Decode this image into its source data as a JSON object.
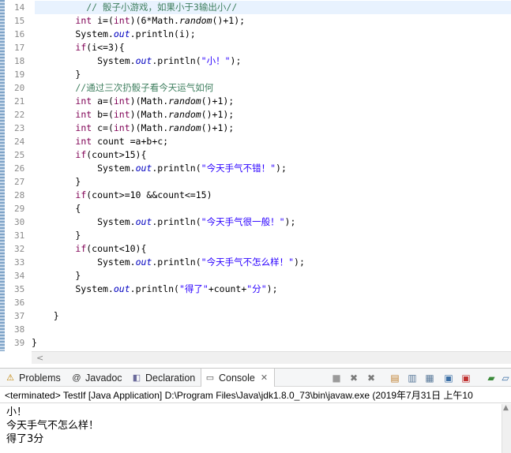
{
  "editor": {
    "line_numbers": [
      "14",
      "15",
      "16",
      "17",
      "18",
      "19",
      "20",
      "21",
      "22",
      "23",
      "24",
      "25",
      "26",
      "27",
      "28",
      "29",
      "30",
      "31",
      "32",
      "33",
      "34",
      "35",
      "36",
      "37",
      "38",
      "39"
    ],
    "lines": [
      [
        {
          "t": "          // 骰子小游戏，如果小于3输出小//",
          "c": "cm"
        }
      ],
      [
        {
          "t": "        ",
          "c": ""
        },
        {
          "t": "int",
          "c": "kw"
        },
        {
          "t": " i=(",
          "c": ""
        },
        {
          "t": "int",
          "c": "kw"
        },
        {
          "t": ")(6*Math.",
          "c": ""
        },
        {
          "t": "random",
          "c": "it"
        },
        {
          "t": "()+1);",
          "c": ""
        }
      ],
      [
        {
          "t": "        System.",
          "c": ""
        },
        {
          "t": "out",
          "c": "fld"
        },
        {
          "t": ".println(i);",
          "c": ""
        }
      ],
      [
        {
          "t": "        ",
          "c": ""
        },
        {
          "t": "if",
          "c": "kw"
        },
        {
          "t": "(i<=3){",
          "c": ""
        }
      ],
      [
        {
          "t": "            System.",
          "c": ""
        },
        {
          "t": "out",
          "c": "fld"
        },
        {
          "t": ".println(",
          "c": ""
        },
        {
          "t": "\"小！\"",
          "c": "st"
        },
        {
          "t": ");",
          "c": ""
        }
      ],
      [
        {
          "t": "        }",
          "c": ""
        }
      ],
      [
        {
          "t": "        //通过三次扔骰子看今天运气如何",
          "c": "cm"
        }
      ],
      [
        {
          "t": "        ",
          "c": ""
        },
        {
          "t": "int",
          "c": "kw"
        },
        {
          "t": " a=(",
          "c": ""
        },
        {
          "t": "int",
          "c": "kw"
        },
        {
          "t": ")(Math.",
          "c": ""
        },
        {
          "t": "random",
          "c": "it"
        },
        {
          "t": "()+1);",
          "c": ""
        }
      ],
      [
        {
          "t": "        ",
          "c": ""
        },
        {
          "t": "int",
          "c": "kw"
        },
        {
          "t": " b=(",
          "c": ""
        },
        {
          "t": "int",
          "c": "kw"
        },
        {
          "t": ")(Math.",
          "c": ""
        },
        {
          "t": "random",
          "c": "it"
        },
        {
          "t": "()+1);",
          "c": ""
        }
      ],
      [
        {
          "t": "        ",
          "c": ""
        },
        {
          "t": "int",
          "c": "kw"
        },
        {
          "t": " c=(",
          "c": ""
        },
        {
          "t": "int",
          "c": "kw"
        },
        {
          "t": ")(Math.",
          "c": ""
        },
        {
          "t": "random",
          "c": "it"
        },
        {
          "t": "()+1);",
          "c": ""
        }
      ],
      [
        {
          "t": "        ",
          "c": ""
        },
        {
          "t": "int",
          "c": "kw"
        },
        {
          "t": " count =a+b+c;",
          "c": ""
        }
      ],
      [
        {
          "t": "        ",
          "c": ""
        },
        {
          "t": "if",
          "c": "kw"
        },
        {
          "t": "(count>15){",
          "c": ""
        }
      ],
      [
        {
          "t": "            System.",
          "c": ""
        },
        {
          "t": "out",
          "c": "fld"
        },
        {
          "t": ".println(",
          "c": ""
        },
        {
          "t": "\"今天手气不错！\"",
          "c": "st"
        },
        {
          "t": ");",
          "c": ""
        }
      ],
      [
        {
          "t": "        }",
          "c": ""
        }
      ],
      [
        {
          "t": "        ",
          "c": ""
        },
        {
          "t": "if",
          "c": "kw"
        },
        {
          "t": "(count>=10 &&count<=15)",
          "c": ""
        }
      ],
      [
        {
          "t": "        {",
          "c": ""
        }
      ],
      [
        {
          "t": "            System.",
          "c": ""
        },
        {
          "t": "out",
          "c": "fld"
        },
        {
          "t": ".println(",
          "c": ""
        },
        {
          "t": "\"今天手气很一般！\"",
          "c": "st"
        },
        {
          "t": ");",
          "c": ""
        }
      ],
      [
        {
          "t": "        }",
          "c": ""
        }
      ],
      [
        {
          "t": "        ",
          "c": ""
        },
        {
          "t": "if",
          "c": "kw"
        },
        {
          "t": "(count<10){",
          "c": ""
        }
      ],
      [
        {
          "t": "            System.",
          "c": ""
        },
        {
          "t": "out",
          "c": "fld"
        },
        {
          "t": ".println(",
          "c": ""
        },
        {
          "t": "\"今天手气不怎么样！\"",
          "c": "st"
        },
        {
          "t": ");",
          "c": ""
        }
      ],
      [
        {
          "t": "        }",
          "c": ""
        }
      ],
      [
        {
          "t": "        System.",
          "c": ""
        },
        {
          "t": "out",
          "c": "fld"
        },
        {
          "t": ".println(",
          "c": ""
        },
        {
          "t": "\"得了\"",
          "c": "st"
        },
        {
          "t": "+count+",
          "c": ""
        },
        {
          "t": "\"分\"",
          "c": "st"
        },
        {
          "t": ");",
          "c": ""
        }
      ],
      [
        {
          "t": "",
          "c": ""
        }
      ],
      [
        {
          "t": "    }",
          "c": ""
        }
      ],
      [
        {
          "t": "",
          "c": ""
        }
      ],
      [
        {
          "t": "}",
          "c": ""
        }
      ]
    ],
    "colors": {
      "keyword": "#7f0055",
      "comment": "#3f7f5f",
      "string": "#2a00ff",
      "field": "#0000c0",
      "current_line": "#e8f2fe"
    }
  },
  "console_panel": {
    "tabs": [
      {
        "label": "Problems",
        "icon": "problems-icon",
        "glyph": "⚠",
        "color": "#c08000",
        "active": false
      },
      {
        "label": "Javadoc",
        "icon": "at-icon",
        "glyph": "@",
        "color": "#333333",
        "active": false
      },
      {
        "label": "Declaration",
        "icon": "declaration-icon",
        "glyph": "◧",
        "color": "#6b6b9b",
        "active": false
      },
      {
        "label": "Console",
        "icon": "console-icon",
        "glyph": "▭",
        "color": "#4a4a4a",
        "active": true
      }
    ],
    "close_glyph": "✕",
    "toolbar_buttons": [
      {
        "name": "terminate-icon",
        "glyph": "■",
        "color": "#9a9a9a"
      },
      {
        "name": "remove-launch-icon",
        "glyph": "✖",
        "color": "#7a7a7a"
      },
      {
        "name": "remove-all-icon",
        "glyph": "✖",
        "color": "#7a7a7a"
      },
      {
        "name": "clear-console-icon",
        "glyph": "▤",
        "color": "#c08030"
      },
      {
        "name": "scroll-lock-icon",
        "glyph": "▥",
        "color": "#5a7a9a"
      },
      {
        "name": "word-wrap-icon",
        "glyph": "▦",
        "color": "#5a7a9a"
      },
      {
        "name": "show-on-output-icon",
        "glyph": "▣",
        "color": "#3a6ea5"
      },
      {
        "name": "show-on-error-icon",
        "glyph": "▣",
        "color": "#c03030"
      },
      {
        "name": "pin-console-icon",
        "glyph": "▰",
        "color": "#3a8a3a"
      },
      {
        "name": "display-console-icon",
        "glyph": "▱",
        "color": "#3a6ea5"
      }
    ],
    "status": "<terminated> TestIf [Java Application] D:\\Program Files\\Java\\jdk1.8.0_73\\bin\\javaw.exe (2019年7月31日 上午10",
    "output": [
      "小！",
      "今天手气不怎么样！",
      "得了3分"
    ]
  }
}
